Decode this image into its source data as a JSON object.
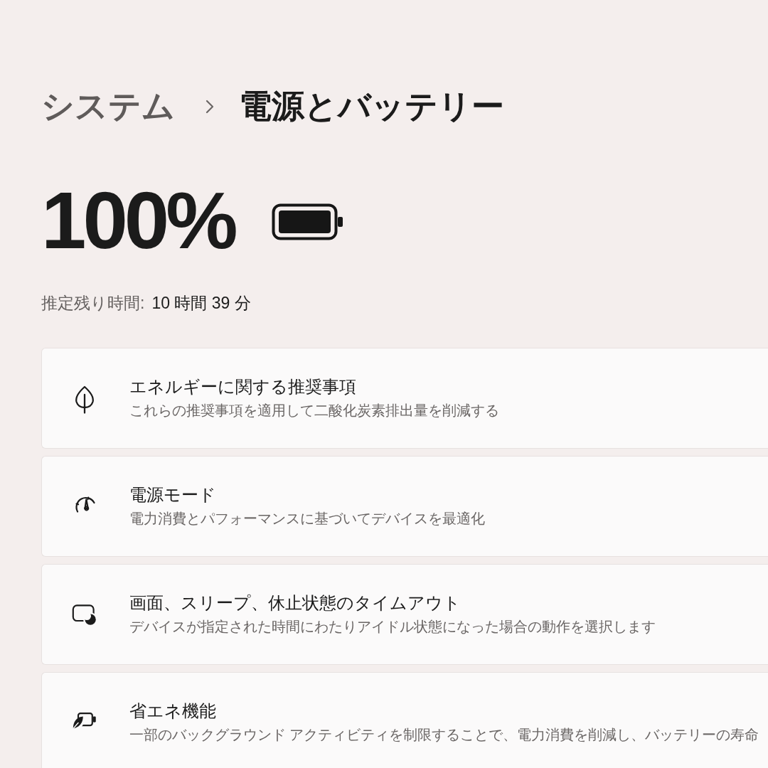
{
  "breadcrumb": {
    "parent": "システム",
    "current": "電源とバッテリー"
  },
  "battery": {
    "percent": "100%",
    "estimate_label": "推定残り時間:",
    "estimate_value": "10 時間 39 分"
  },
  "settings": [
    {
      "title": "エネルギーに関する推奨事項",
      "description": "これらの推奨事項を適用して二酸化炭素排出量を削減する"
    },
    {
      "title": "電源モード",
      "description": "電力消費とパフォーマンスに基づいてデバイスを最適化"
    },
    {
      "title": "画面、スリープ、休止状態のタイムアウト",
      "description": "デバイスが指定された時間にわたりアイドル状態になった場合の動作を選択します"
    },
    {
      "title": "省エネ機能",
      "description": "一部のバックグラウンド アクティビティを制限することで、電力消費を削減し、バッテリーの寿命"
    }
  ]
}
